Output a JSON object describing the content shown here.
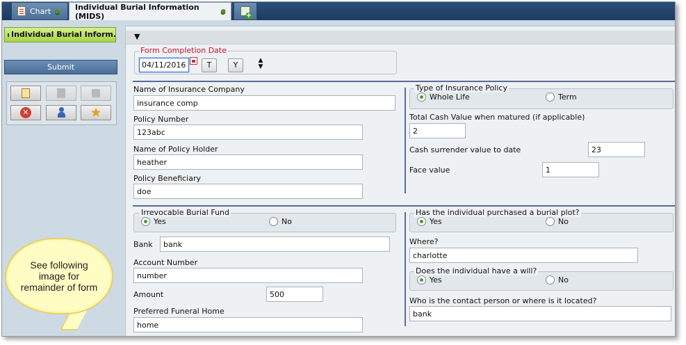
{
  "tabs": [
    {
      "label": "Chart",
      "active": false
    },
    {
      "label": "Individual Burial Information (MIDS)",
      "active": true
    }
  ],
  "sidebar": {
    "nav_item": "Individual Burial Inform...",
    "submit_label": "Submit",
    "icons": [
      "edit-note-icon",
      "page-icon",
      "sticky-note-icon",
      "cancel-icon",
      "remove-user-icon",
      "favorite-star-icon"
    ]
  },
  "callout": {
    "text": "See following image for remainder of form"
  },
  "form": {
    "completion_date": {
      "legend": "Form Completion Date",
      "value": "04/11/2016",
      "today_btn": "T",
      "year_btn": "Y"
    },
    "insurance_company": {
      "label": "Name of Insurance Company",
      "value": "insurance comp"
    },
    "policy_number": {
      "label": "Policy Number",
      "value": "123abc"
    },
    "policy_holder": {
      "label": "Name of Policy Holder",
      "value": "heather"
    },
    "beneficiary": {
      "label": "Policy Beneficiary",
      "value": "doe"
    },
    "policy_type": {
      "legend": "Type of Insurance Policy",
      "options": [
        "Whole Life",
        "Term"
      ],
      "selected": "Whole Life"
    },
    "total_cash_value": {
      "label": "Total Cash Value when matured (if applicable)",
      "value": "2"
    },
    "cash_surrender": {
      "label": "Cash surrender value to date",
      "value": "23"
    },
    "face_value": {
      "label": "Face value",
      "value": "1"
    },
    "burial_fund": {
      "legend": "Irrevocable Burial Fund",
      "options": [
        "Yes",
        "No"
      ],
      "selected": "Yes"
    },
    "bank": {
      "label": "Bank",
      "value": "bank"
    },
    "account_number": {
      "label": "Account Number",
      "value": "number"
    },
    "amount": {
      "label": "Amount",
      "value": "500"
    },
    "funeral_home": {
      "label": "Preferred Funeral Home",
      "value": "home"
    },
    "burial_plot": {
      "legend": "Has the individual purchased a burial plot?",
      "options": [
        "Yes",
        "No"
      ],
      "selected": "Yes"
    },
    "where": {
      "label": "Where?",
      "value": "charlotte"
    },
    "will": {
      "legend": "Does the individual have a will?",
      "options": [
        "Yes",
        "No"
      ],
      "selected": "Yes"
    },
    "contact_person": {
      "label": "Who is the contact person or where is it located?",
      "value": "bank"
    }
  },
  "colors": {
    "accent_green": "#a9d34a",
    "header_blue": "#1d3a5e",
    "divider": "#5d6a9a",
    "required_red": "#c8102e"
  }
}
